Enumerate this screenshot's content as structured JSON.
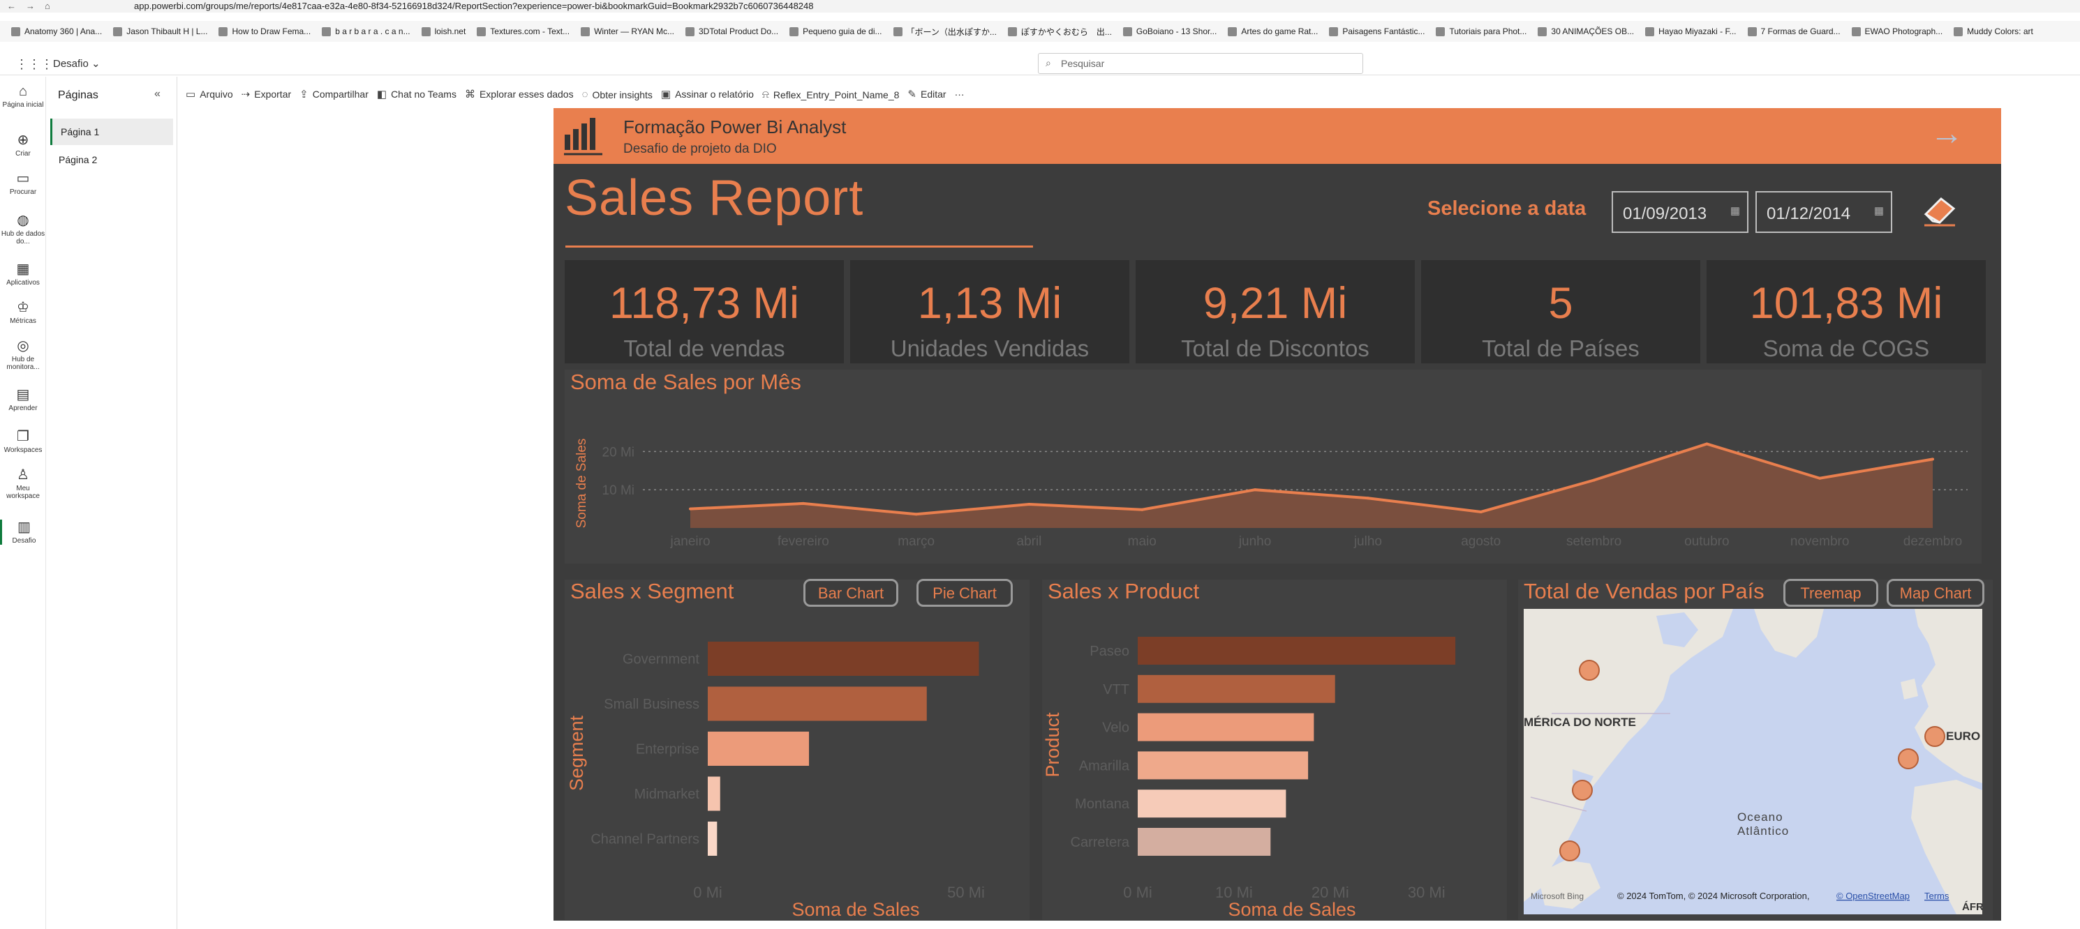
{
  "browser": {
    "url": "app.powerbi.com/groups/me/reports/4e817caa-e32a-4e80-8f34-52166918d324/ReportSection?experience=power-bi&bookmarkGuid=Bookmark2932b7c6060736448248"
  },
  "bookmarks": [
    "Anatomy 360 | Ana...",
    "Jason Thibault H | L...",
    "How to Draw Fema...",
    "b a r b a r a . c a n...",
    "loish.net",
    "Textures.com - Text...",
    "Winter — RYAN Mc...",
    "3DTotal Product Do...",
    "Pequeno guia de di...",
    "「ボーン（出水ぽすか...",
    "ぽすかやくおむら　出...",
    "GoBoiano - 13 Shor...",
    "Artes do game Rat...",
    "Paisagens Fantástic...",
    "Tutoriais para Phot...",
    "30 ANIMAÇÕES OB...",
    "Hayao Miyazaki - F...",
    "7 Formas de Guard...",
    "EWAO Photograph...",
    "Muddy Colors: art"
  ],
  "appbar": {
    "workspace": "Desafio",
    "search_placeholder": "Pesquisar"
  },
  "leftnav": [
    {
      "label": "Página inicial",
      "icon": "home-icon"
    },
    {
      "label": "Criar",
      "icon": "plus-icon"
    },
    {
      "label": "Procurar",
      "icon": "folder-icon"
    },
    {
      "label": "Hub de dados do...",
      "icon": "data-hub-icon"
    },
    {
      "label": "Aplicativos",
      "icon": "apps-icon"
    },
    {
      "label": "Métricas",
      "icon": "trophy-icon"
    },
    {
      "label": "Hub de monitora...",
      "icon": "monitor-icon"
    },
    {
      "label": "Aprender",
      "icon": "book-icon"
    },
    {
      "label": "Workspaces",
      "icon": "workspaces-icon"
    },
    {
      "label": "Meu workspace",
      "icon": "person-icon"
    },
    {
      "label": "Desafio",
      "icon": "report-icon"
    }
  ],
  "pages_panel": {
    "title": "Páginas",
    "pages": [
      "Página 1",
      "Página 2"
    ]
  },
  "toolbar": [
    "Arquivo",
    "Exportar",
    "Compartilhar",
    "Chat no Teams",
    "Explorar esses dados",
    "Obter insights",
    "Assinar o relatório",
    "Reflex_Entry_Point_Name_8",
    "Editar",
    "···"
  ],
  "report": {
    "banner_title": "Formação Power Bi Analyst",
    "banner_subtitle": "Desafio de projeto da DIO",
    "title": "Sales Report",
    "select_date_label": "Selecione a data",
    "date_from": "01/09/2013",
    "date_to": "01/12/2014",
    "kpis": [
      {
        "value": "118,73 Mi",
        "label": "Total de vendas"
      },
      {
        "value": "1,13 Mi",
        "label": "Unidades Vendidas"
      },
      {
        "value": "9,21 Mi",
        "label": "Total de Discontos"
      },
      {
        "value": "5",
        "label": "Total de Países"
      },
      {
        "value": "101,83 Mi",
        "label": "Soma de COGS"
      }
    ],
    "line_title": "Soma de Sales por Mês",
    "segment_title": "Sales x Segment",
    "segment_buttons": [
      "Bar Chart",
      "Pie Chart"
    ],
    "product_title": "Sales x Product",
    "country_title": "Total de Vendas por País",
    "country_buttons": [
      "Treemap",
      "Map Chart"
    ],
    "map": {
      "labels": [
        "MÉRICA DO NORTE",
        "EURO",
        "Oceano Atlântico",
        "ÁFR"
      ],
      "attribution": "© 2024 TomTom, © 2024 Microsoft Corporation,",
      "osm": "© OpenStreetMap",
      "terms": "Terms",
      "bing": "Microsoft Bing"
    },
    "accent": "#e97f4e"
  },
  "chart_data": [
    {
      "type": "area",
      "title": "Soma de Sales por Mês",
      "xlabel": "",
      "ylabel": "Soma de Sales",
      "categories": [
        "janeiro",
        "fevereiro",
        "março",
        "abril",
        "maio",
        "junho",
        "julho",
        "agosto",
        "setembro",
        "outubro",
        "novembro",
        "dezembro"
      ],
      "values": [
        5.0,
        6.4,
        3.6,
        6.2,
        4.8,
        10.0,
        7.8,
        4.2,
        12.5,
        22.0,
        13.0,
        18.0
      ],
      "yticks": [
        "10 Mi",
        "20 Mi"
      ],
      "ylim": [
        0,
        25
      ],
      "grid": true
    },
    {
      "type": "bar",
      "title": "Sales x Segment",
      "xlabel": "Soma de Sales",
      "ylabel": "Segment",
      "categories": [
        "Government",
        "Small Business",
        "Enterprise",
        "Midmarket",
        "Channel Partners"
      ],
      "values": [
        52.5,
        42.4,
        19.6,
        2.4,
        1.8
      ],
      "xticks": [
        "0 Mi",
        "50 Mi"
      ],
      "xlim": [
        0,
        60
      ],
      "colors": [
        "#7c3e27",
        "#b0603f",
        "#ec9b7a",
        "#f6c4ae",
        "#fad8c8"
      ]
    },
    {
      "type": "bar",
      "title": "Sales x Product",
      "xlabel": "Soma de Sales",
      "ylabel": "Product",
      "categories": [
        "Paseo",
        "VTT",
        "Velo",
        "Amarilla",
        "Montana",
        "Carretera"
      ],
      "values": [
        33.0,
        20.5,
        18.3,
        17.7,
        15.4,
        13.8
      ],
      "xticks": [
        "0 Mi",
        "10 Mi",
        "20 Mi",
        "30 Mi"
      ],
      "xlim": [
        0,
        33.5
      ],
      "colors": [
        "#7c3e27",
        "#b0603f",
        "#ec9b7a",
        "#efa98b",
        "#f6cbb8",
        "#d4aea0"
      ]
    }
  ]
}
